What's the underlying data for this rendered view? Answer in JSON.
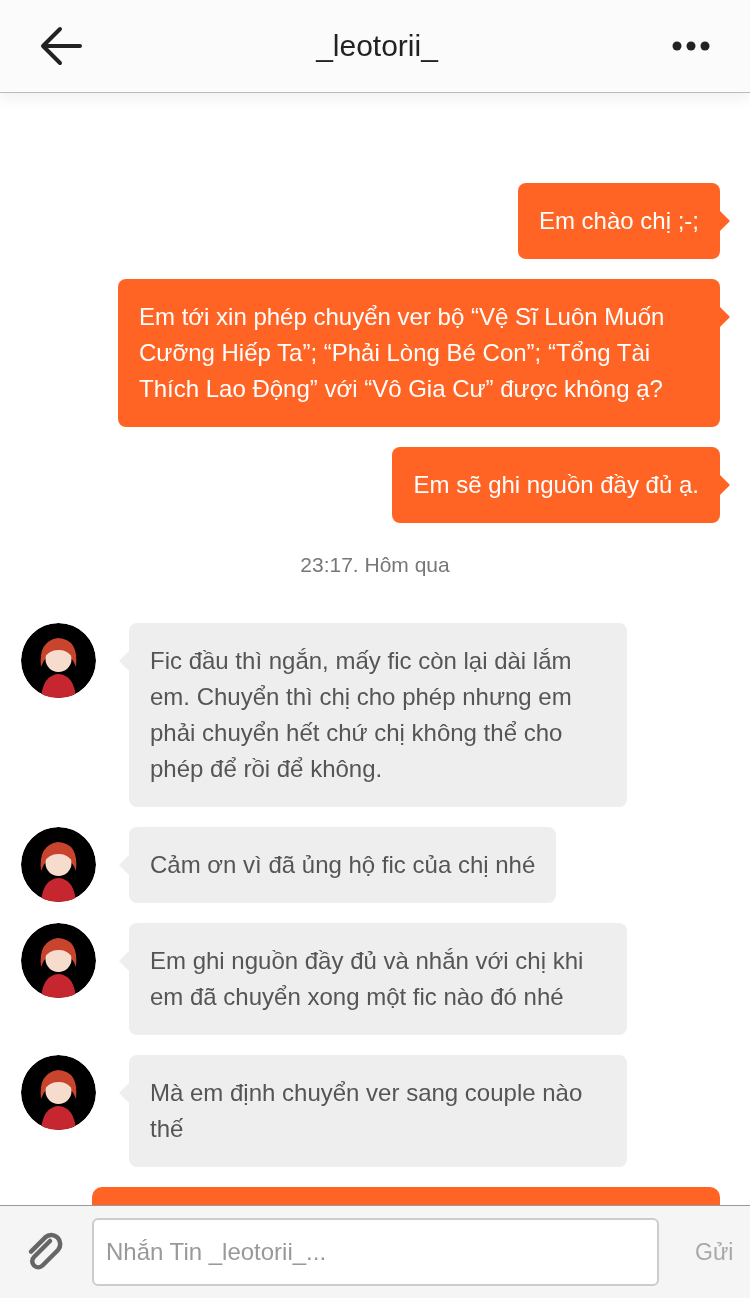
{
  "header": {
    "title": "_leotorii_"
  },
  "messages": [
    {
      "kind": "sent",
      "text": "Em chào chị ;-;"
    },
    {
      "kind": "sent",
      "text": "Em tới xin phép chuyển ver bộ “Vệ Sĩ Luôn Muốn Cưỡng Hiếp Ta”; “Phải Lòng Bé Con”; “Tổng Tài Thích Lao Động” với “Vô Gia Cư” được không ạ?"
    },
    {
      "kind": "sent",
      "text": "Em sẽ ghi nguồn đầy đủ ạ."
    },
    {
      "kind": "time",
      "text": "23:17. Hôm qua"
    },
    {
      "kind": "received",
      "text": "Fic đầu thì ngắn, mấy fic còn lại dài lắm em. Chuyển thì chị cho phép nhưng em phải chuyển hết chứ chị không thể cho phép để rồi để không."
    },
    {
      "kind": "received",
      "text": "Cảm ơn vì đã ủng hộ fic của chị nhé"
    },
    {
      "kind": "received",
      "text": "Em ghi nguồn đầy đủ và nhắn với chị khi em đã chuyển xong một fic nào đó nhé"
    },
    {
      "kind": "received",
      "text": "Mà em định chuyển ver sang couple nào thế"
    },
    {
      "kind": "sent_cut"
    }
  ],
  "composer": {
    "placeholder": "Nhắn Tin _leotorii_...",
    "send_label": "Gửi",
    "send_disabled": true
  }
}
